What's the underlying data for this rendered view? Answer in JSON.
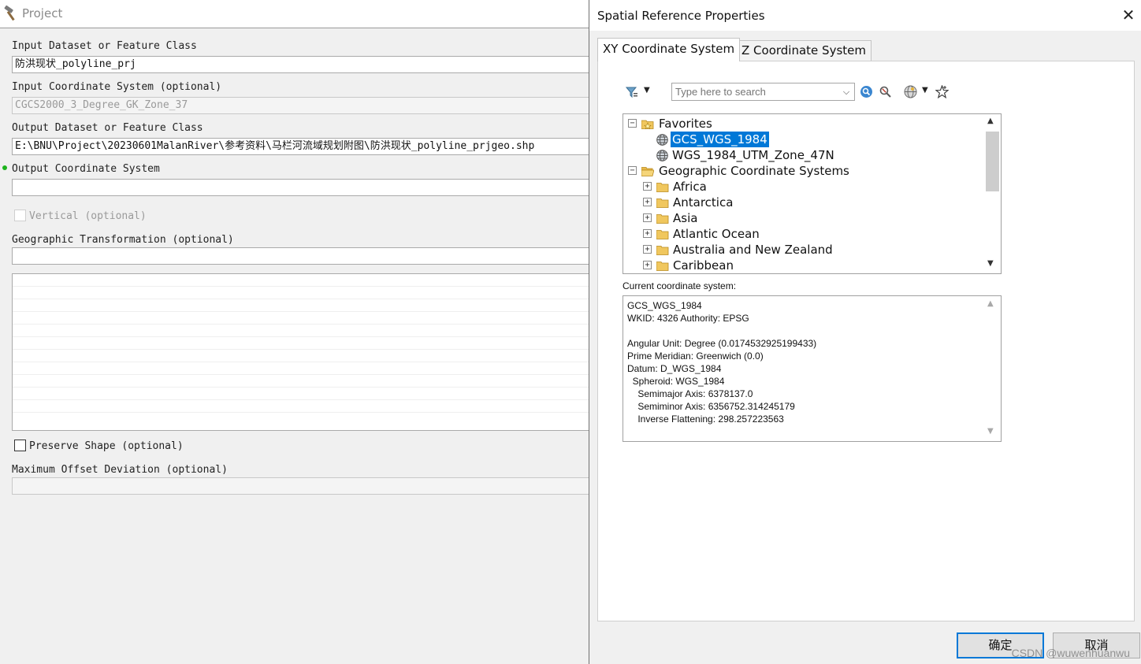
{
  "tool": {
    "title": "Project",
    "icon": "hammer-icon",
    "input_dataset_label": "Input Dataset or Feature Class",
    "input_dataset_value": "防洪现状_polyline_prj",
    "input_cs_label": "Input Coordinate System (optional)",
    "input_cs_value": "CGCS2000_3_Degree_GK_Zone_37",
    "output_dataset_label": "Output Dataset or Feature Class",
    "output_dataset_value": "E:\\BNU\\Project\\20230601MalanRiver\\参考资料\\马栏河流域规划附图\\防洪现状_polyline_prjgeo.shp",
    "output_cs_label": "Output Coordinate System",
    "output_cs_value": "",
    "vertical_label": "Vertical (optional)",
    "geo_transform_label": "Geographic Transformation (optional)",
    "geo_transform_value": "",
    "preserve_shape_label": "Preserve Shape (optional)",
    "max_offset_label": "Maximum Offset Deviation (optional)",
    "max_offset_value": ""
  },
  "dialog": {
    "title": "Spatial Reference Properties",
    "close_icon": "close-icon",
    "tabs": [
      "XY Coordinate System",
      "Z Coordinate System"
    ],
    "active_tab": 0,
    "search_placeholder": "Type here to search",
    "toolbar_icons": [
      "filter-icon",
      "search-icon",
      "clear-search-icon",
      "globe-icon",
      "add-favorite-icon"
    ],
    "tree": {
      "favorites_label": "Favorites",
      "favorites": [
        {
          "label": "GCS_WGS_1984",
          "selected": true
        },
        {
          "label": "WGS_1984_UTM_Zone_47N",
          "selected": false
        }
      ],
      "gcs_label": "Geographic Coordinate Systems",
      "gcs_children": [
        "Africa",
        "Antarctica",
        "Asia",
        "Atlantic Ocean",
        "Australia and New Zealand",
        "Caribbean"
      ]
    },
    "current_label": "Current coordinate system:",
    "current_text": "GCS_WGS_1984\nWKID: 4326 Authority: EPSG\n\nAngular Unit: Degree (0.0174532925199433)\nPrime Meridian: Greenwich (0.0)\nDatum: D_WGS_1984\n  Spheroid: WGS_1984\n    Semimajor Axis: 6378137.0\n    Semiminor Axis: 6356752.314245179\n    Inverse Flattening: 298.257223563",
    "ok_label": "确定",
    "cancel_label": "取消",
    "accent_color": "#0078d7"
  },
  "watermark": "CSDN @wuwenhuanwu"
}
